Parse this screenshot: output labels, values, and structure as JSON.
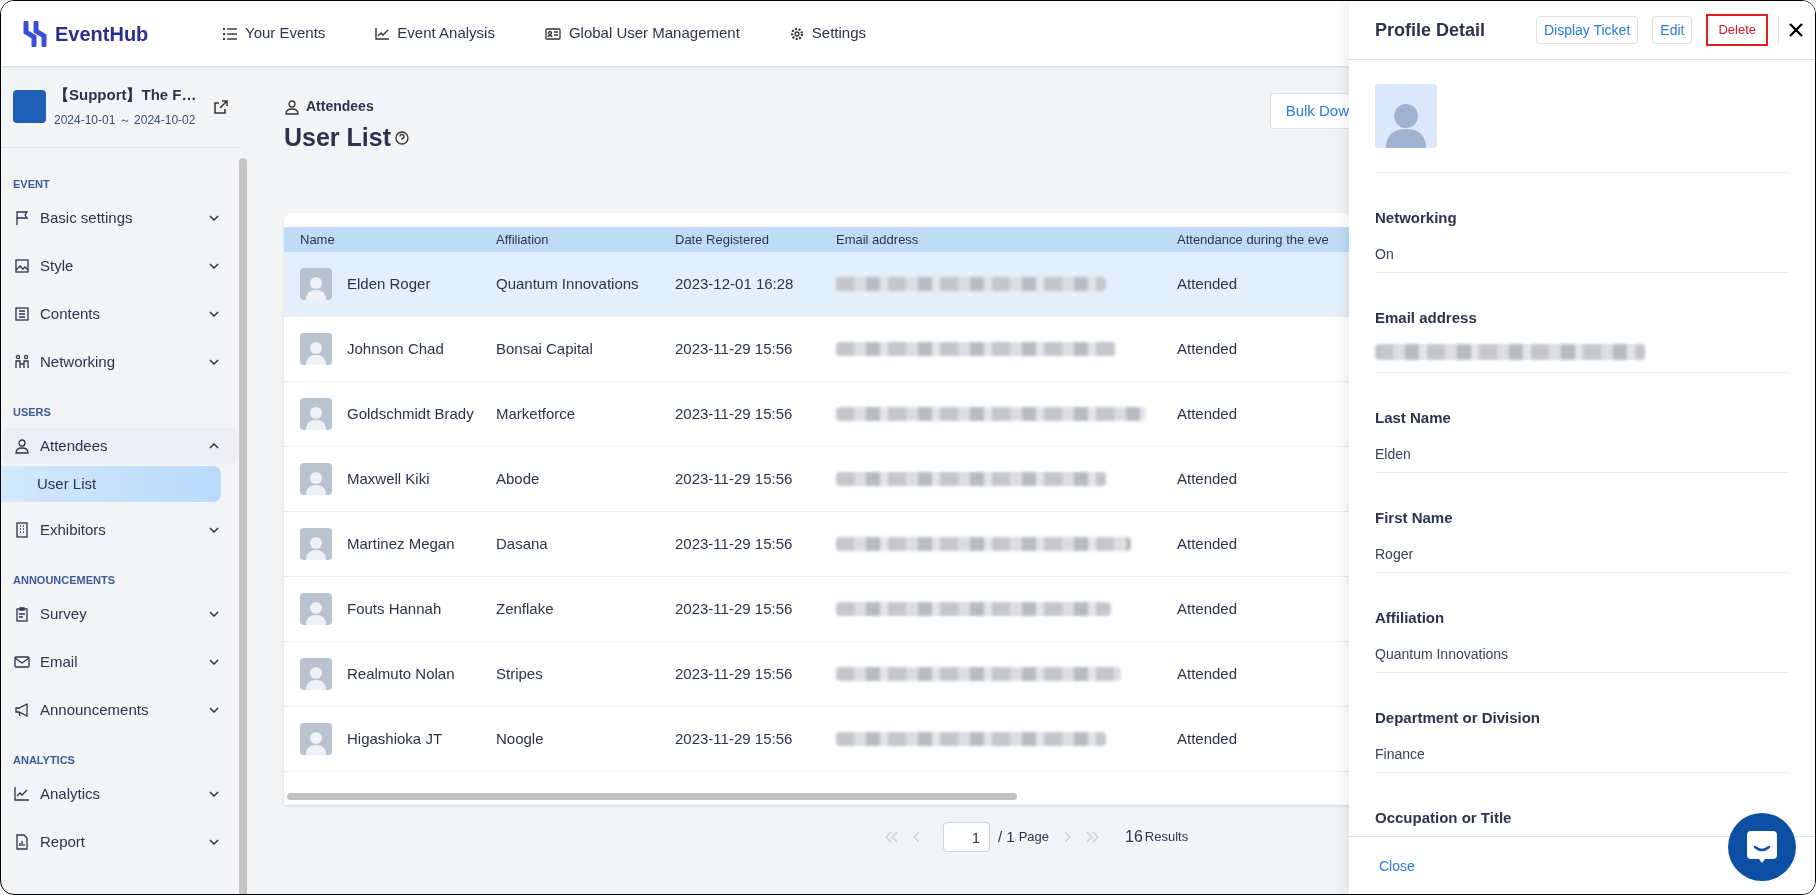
{
  "app": {
    "logo": "EventHub"
  },
  "top_nav": [
    {
      "label": "Your Events"
    },
    {
      "label": "Event Analysis"
    },
    {
      "label": "Global User Management"
    },
    {
      "label": "Settings"
    }
  ],
  "event": {
    "title": "【Support】The F…",
    "dates": "2024-10-01 ～ 2024-10-02"
  },
  "sidebar": {
    "sections": [
      {
        "heading": "EVENT",
        "items": [
          {
            "label": "Basic settings",
            "expanded": false
          },
          {
            "label": "Style",
            "expanded": false
          },
          {
            "label": "Contents",
            "expanded": false
          },
          {
            "label": "Networking",
            "expanded": false
          }
        ]
      },
      {
        "heading": "USERS",
        "items": [
          {
            "label": "Attendees",
            "expanded": true,
            "children": [
              {
                "label": "User List",
                "selected": true
              }
            ]
          },
          {
            "label": "Exhibitors",
            "expanded": false
          }
        ]
      },
      {
        "heading": "ANNOUNCEMENTS",
        "items": [
          {
            "label": "Survey",
            "expanded": false
          },
          {
            "label": "Email",
            "expanded": false
          },
          {
            "label": "Announcements",
            "expanded": false
          }
        ]
      },
      {
        "heading": "ANALYTICS",
        "items": [
          {
            "label": "Analytics",
            "expanded": false
          },
          {
            "label": "Report",
            "expanded": false
          }
        ]
      }
    ]
  },
  "page": {
    "breadcrumb": "Attendees",
    "title": "User List",
    "bulk_button": "Bulk Dow"
  },
  "table": {
    "columns": [
      "Name",
      "Affiliation",
      "Date Registered",
      "Email address",
      "Attendance during the eve"
    ],
    "rows": [
      {
        "name": "Elden Roger",
        "affiliation": "Quantum Innovations",
        "date": "2023-12-01 16:28",
        "attendance": "Attended",
        "selected": true
      },
      {
        "name": "Johnson Chad",
        "affiliation": "Bonsai Capital",
        "date": "2023-11-29 15:56",
        "attendance": "Attended",
        "selected": false
      },
      {
        "name": "Goldschmidt Brady",
        "affiliation": "Marketforce",
        "date": "2023-11-29 15:56",
        "attendance": "Attended",
        "selected": false
      },
      {
        "name": "Maxwell Kiki",
        "affiliation": "Abode",
        "date": "2023-11-29 15:56",
        "attendance": "Attended",
        "selected": false
      },
      {
        "name": "Martinez Megan",
        "affiliation": "Dasana",
        "date": "2023-11-29 15:56",
        "attendance": "Attended",
        "selected": false
      },
      {
        "name": "Fouts Hannah",
        "affiliation": "Zenflake",
        "date": "2023-11-29 15:56",
        "attendance": "Attended",
        "selected": false
      },
      {
        "name": "Realmuto Nolan",
        "affiliation": "Stripes",
        "date": "2023-11-29 15:56",
        "attendance": "Attended",
        "selected": false
      },
      {
        "name": "Higashioka JT",
        "affiliation": "Noogle",
        "date": "2023-11-29 15:56",
        "attendance": "Attended",
        "selected": false
      }
    ]
  },
  "pagination": {
    "page": "1",
    "of": "/ 1",
    "page_label": "Page",
    "count": "16",
    "count_label": "Results"
  },
  "profile": {
    "title": "Profile Detail",
    "buttons": [
      {
        "label": "Display Ticket",
        "kind": "default"
      },
      {
        "label": "Edit",
        "kind": "default"
      },
      {
        "label": "Delete",
        "kind": "danger"
      }
    ],
    "fields": [
      {
        "label": "Networking",
        "kind": "text",
        "value": "On"
      },
      {
        "label": "Email address",
        "kind": "blurred"
      },
      {
        "label": "Last Name",
        "kind": "text",
        "value": "Elden"
      },
      {
        "label": "First Name",
        "kind": "text",
        "value": "Roger"
      },
      {
        "label": "Affiliation",
        "kind": "text",
        "value": "Quantum Innovations"
      },
      {
        "label": "Department or Division",
        "kind": "text",
        "value": "Finance"
      },
      {
        "label": "Occupation or Title",
        "kind": "empty"
      }
    ],
    "footer_button": "Close"
  }
}
